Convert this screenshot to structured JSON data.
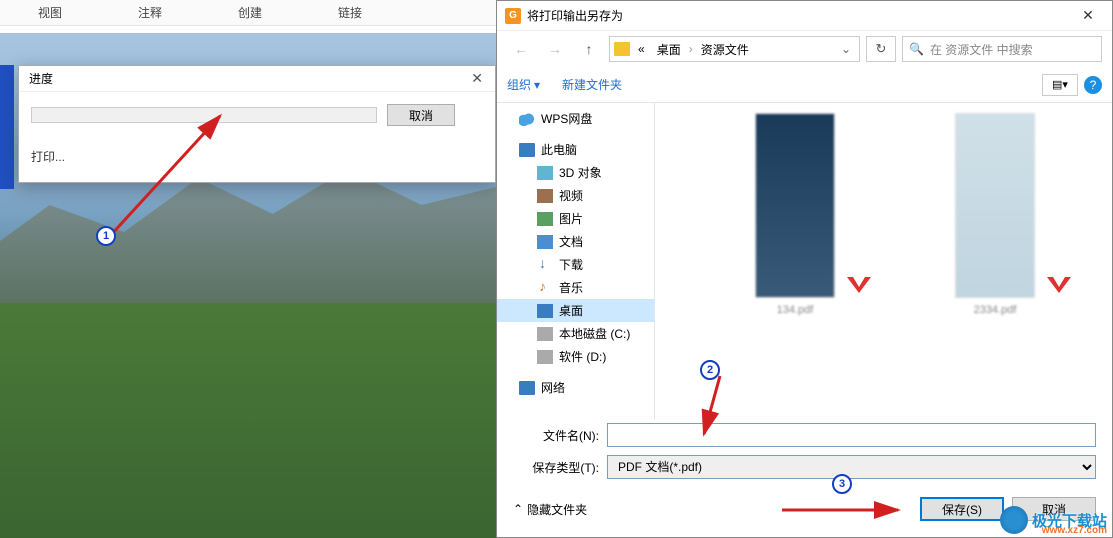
{
  "topbar": {
    "items": [
      "视图",
      "注释",
      "创建",
      "链接"
    ]
  },
  "progress_dialog": {
    "title": "进度",
    "cancel_label": "取消",
    "status_text": "打印..."
  },
  "save_dialog": {
    "title": "将打印输出另存为",
    "breadcrumb": {
      "part1": "桌面",
      "part2": "资源文件"
    },
    "search_placeholder": "在 资源文件 中搜索",
    "toolbar": {
      "organize": "组织",
      "new_folder": "新建文件夹"
    },
    "tree": {
      "wps": "WPS网盘",
      "pc": "此电脑",
      "obj3d": "3D 对象",
      "video": "视频",
      "pic": "图片",
      "doc": "文档",
      "dl": "下载",
      "music": "音乐",
      "desktop": "桌面",
      "cdrive": "本地磁盘 (C:)",
      "ddrive": "软件 (D:)",
      "network": "网络"
    },
    "files": {
      "f1": "134.pdf",
      "f2": "2334.pdf"
    },
    "fields": {
      "filename_label": "文件名(N):",
      "filename_value": "",
      "filetype_label": "保存类型(T):",
      "filetype_value": "PDF 文档(*.pdf)"
    },
    "footer": {
      "hide_folders": "隐藏文件夹",
      "save": "保存(S)",
      "cancel": "取消"
    }
  },
  "annotations": {
    "n1": "1",
    "n2": "2",
    "n3": "3"
  },
  "watermark": {
    "text": "极光下载站",
    "url": "www.xz7.com"
  }
}
